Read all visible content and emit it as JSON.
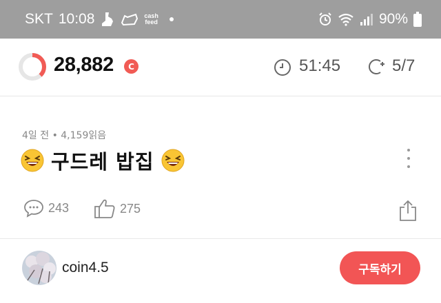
{
  "status_bar": {
    "carrier": "SKT",
    "time": "10:08",
    "cashfeed_label_top": "cash",
    "cashfeed_label_bottom": "feed",
    "battery": "90%"
  },
  "points_header": {
    "points": "28,882",
    "coin_symbol": "C",
    "timer": "51:45",
    "count": "5/7",
    "ring_progress": 0.38,
    "accent_color": "#f15b55"
  },
  "article": {
    "meta": "4일 전 • 4,159읽음",
    "title": "구드레 밥집",
    "comment_count": "243",
    "like_count": "275"
  },
  "author": {
    "name": "coin4.5",
    "subscribe_label": "구독하기"
  },
  "colors": {
    "status_bar_bg": "#9e9e9e",
    "button_red": "#f25555"
  }
}
